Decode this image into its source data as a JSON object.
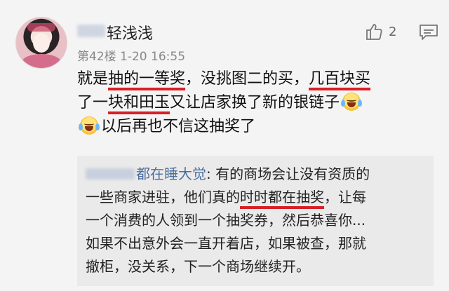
{
  "comment": {
    "username": "轻浅浅",
    "meta": "第42楼 1-20 16:55",
    "like_count": "2",
    "icons": {
      "like": "thumbs-up-icon",
      "reply": "comment-icon",
      "emoji": "laugh-cry-emoji"
    },
    "body": {
      "line1": {
        "p1": "就是",
        "u1": "抽的一等奖",
        "p2": "，没挑图二的买，",
        "u2": "几百块买"
      },
      "line2": {
        "p1": "了一",
        "u1": "块和田玉",
        "p2": "又让店家换了新的银链子"
      },
      "line3": {
        "p1": "以后再也不信这抽奖了"
      }
    }
  },
  "quote": {
    "author": "都在睡大觉",
    "line1": "有的商场会让没有资质的",
    "line2": {
      "p1": "一些商家进驻，他们真的",
      "u1": "时时都在抽奖",
      "p2": "，让每"
    },
    "line3": "一个消费的人领到一个抽奖券，然后恭喜你...",
    "line4": "如果不出意外会一直开着店，如果被查，那就",
    "line5": "撤柜，没关系，下一个商场继续开。"
  },
  "colors": {
    "underline": "#d81f26",
    "quote_author": "#4b6e9e",
    "background": "#f4f4f4",
    "quote_background": "#eaeaea"
  }
}
